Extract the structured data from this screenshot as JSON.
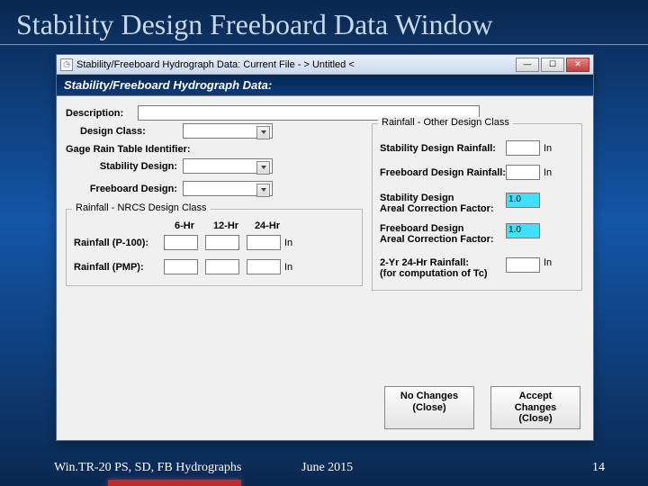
{
  "slide": {
    "title": "Stability Design Freeboard Data Window",
    "footer_left": "Win.TR-20 PS, SD, FB Hydrographs",
    "footer_mid": "June 2015",
    "footer_right": "14"
  },
  "window": {
    "title": "Stability/Freeboard Hydrograph Data:  Current File - > Untitled <",
    "banner": "Stability/Freeboard Hydrograph Data:",
    "labels": {
      "description": "Description:",
      "design_class": "Design Class:",
      "gage_rain": "Gage Rain Table Identifier:",
      "stability_design": "Stability Design:",
      "freeboard_design": "Freeboard Design:",
      "group_nrcs": "Rainfall - NRCS Design Class",
      "group_other": "Rainfall - Other Design Class",
      "col_6hr": "6-Hr",
      "col_12hr": "12-Hr",
      "col_24hr": "24-Hr",
      "rainfall_p100": "Rainfall (P-100):",
      "rainfall_pmp": "Rainfall (PMP):",
      "stability_rain": "Stability Design Rainfall:",
      "freeboard_rain": "Freeboard  Design Rainfall:",
      "stab_areal": "Stability Design\nAreal Correction Factor:",
      "fb_areal": "Freeboard  Design\nAreal Correction Factor:",
      "two_yr": "2-Yr 24-Hr Rainfall:\n(for computation of Tc)",
      "unit_in": "In"
    },
    "values": {
      "description": "",
      "design_class": "",
      "gage_rain": "",
      "stability_design": "",
      "freeboard_design": "",
      "p100_6": "",
      "p100_12": "",
      "p100_24": "",
      "pmp_6": "",
      "pmp_12": "",
      "pmp_24": "",
      "stability_rain": "",
      "freeboard_rain": "",
      "stab_areal": "1.0",
      "fb_areal": "1.0",
      "two_yr": ""
    },
    "buttons": {
      "no_changes": "No Changes\n(Close)",
      "accept_changes": "Accept Changes\n(Close)"
    }
  }
}
